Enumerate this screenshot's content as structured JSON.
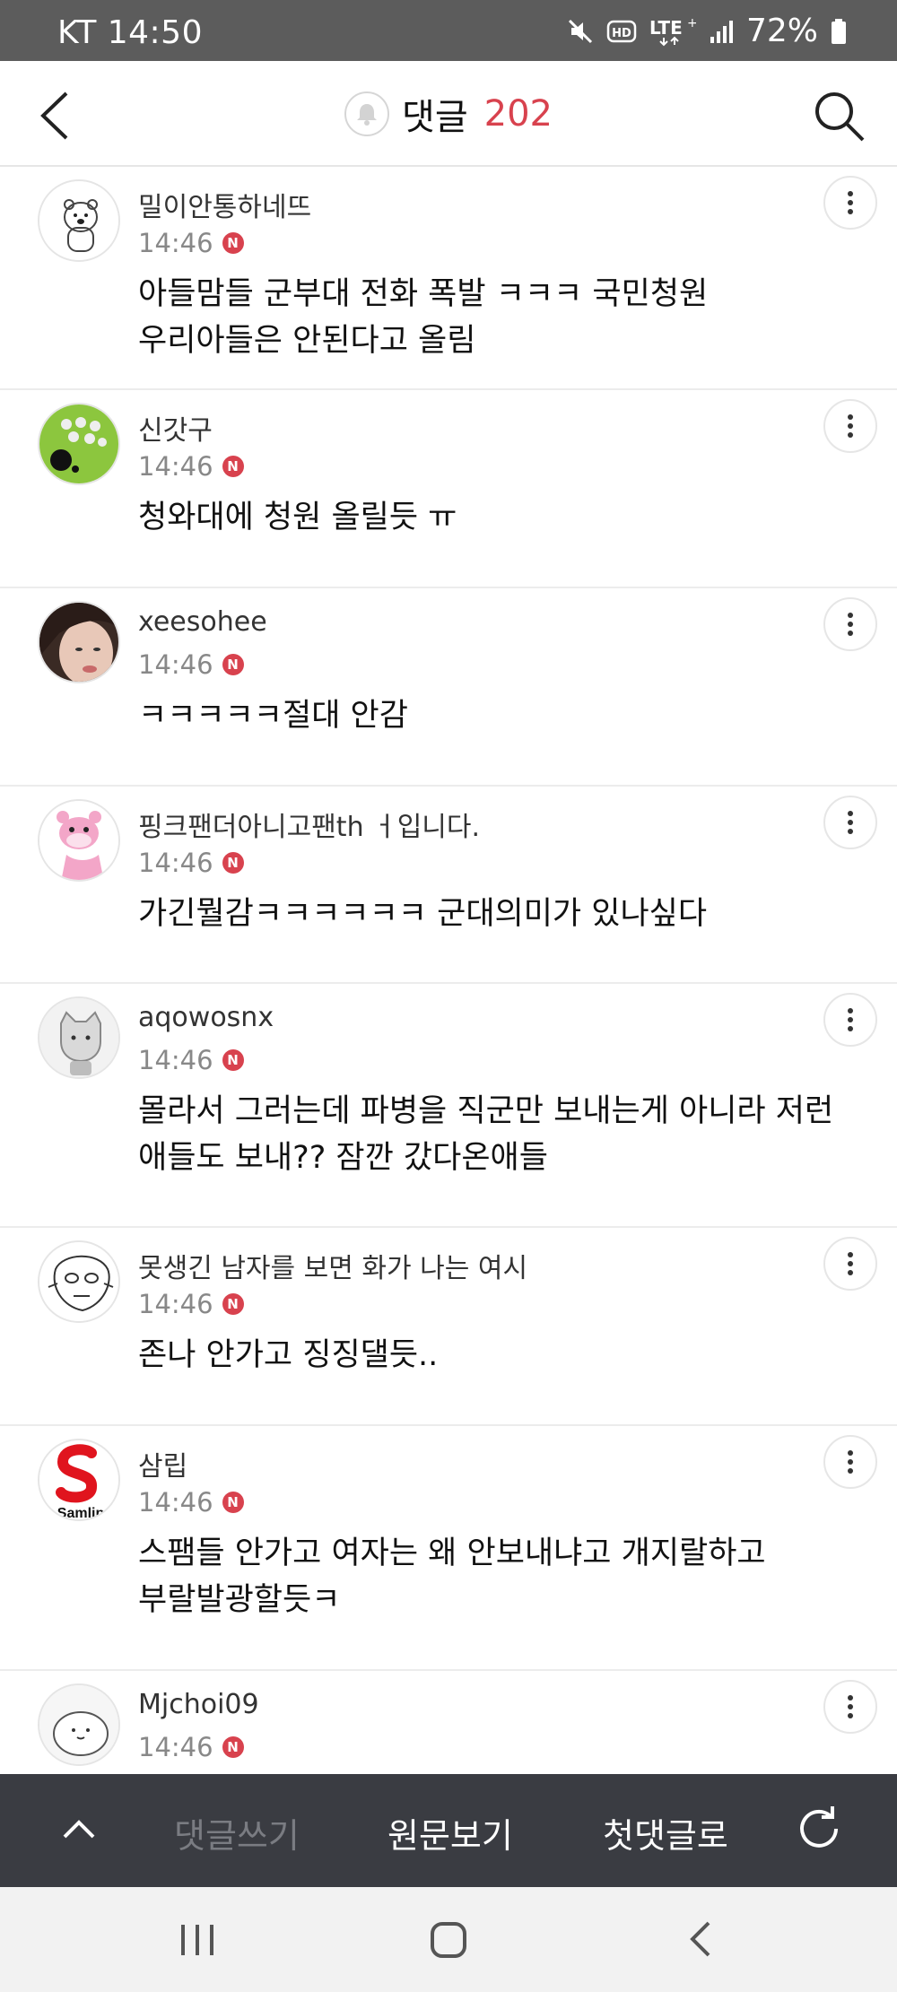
{
  "status_bar": {
    "carrier_time": "KT 14:50",
    "battery": "72%",
    "icons": [
      "mute-icon",
      "hd-icon",
      "lte-icon",
      "signal-icon",
      "battery-icon"
    ]
  },
  "header": {
    "title": "댓글",
    "count": "202",
    "count_color": "#d8424e"
  },
  "comments": [
    {
      "username": "밀이안통하네뜨",
      "time": "14:46",
      "new_badge": "N",
      "lines": [
        "아들맘들 군부대 전화 폭발 ㅋㅋㅋ 국민청원",
        "우리아들은 안된다고 올림"
      ]
    },
    {
      "username": "신갓구",
      "time": "14:46",
      "new_badge": "N",
      "lines": [
        "청와대에 청원 올릴듯 ㅠ"
      ]
    },
    {
      "username": "xeesohee",
      "time": "14:46",
      "new_badge": "N",
      "lines": [
        "ㅋㅋㅋㅋㅋ절대 안감"
      ]
    },
    {
      "username": "핑크팬더아니고팬th ㅓ입니다.",
      "time": "14:46",
      "new_badge": "N",
      "lines": [
        "가긴뭘감ㅋㅋㅋㅋㅋㅋ 군대의미가 있나싶다"
      ]
    },
    {
      "username": "aqowosnx",
      "time": "14:46",
      "new_badge": "N",
      "lines": [
        "몰라서 그러는데 파병을 직군만 보내는게 아니라 저런",
        "애들도 보내?? 잠깐 갔다온애들"
      ]
    },
    {
      "username": "못생긴 남자를 보면 화가 나는 여시",
      "time": "14:46",
      "new_badge": "N",
      "lines": [
        "존나 안가고 징징댈듯.."
      ]
    },
    {
      "username": "삼립",
      "time": "14:46",
      "new_badge": "N",
      "avatar_text": "Samlip",
      "lines": [
        "스팸들 안가고 여자는 왜 안보내냐고 개지랄하고",
        "부랄발광할듯ㅋ"
      ]
    },
    {
      "username": "Mjchoi09",
      "time": "14:46",
      "new_badge": "N",
      "lines": []
    }
  ],
  "bottom_bar": {
    "write_label": "댓글쓰기",
    "original_label": "원문보기",
    "first_comment_label": "첫댓글로"
  }
}
